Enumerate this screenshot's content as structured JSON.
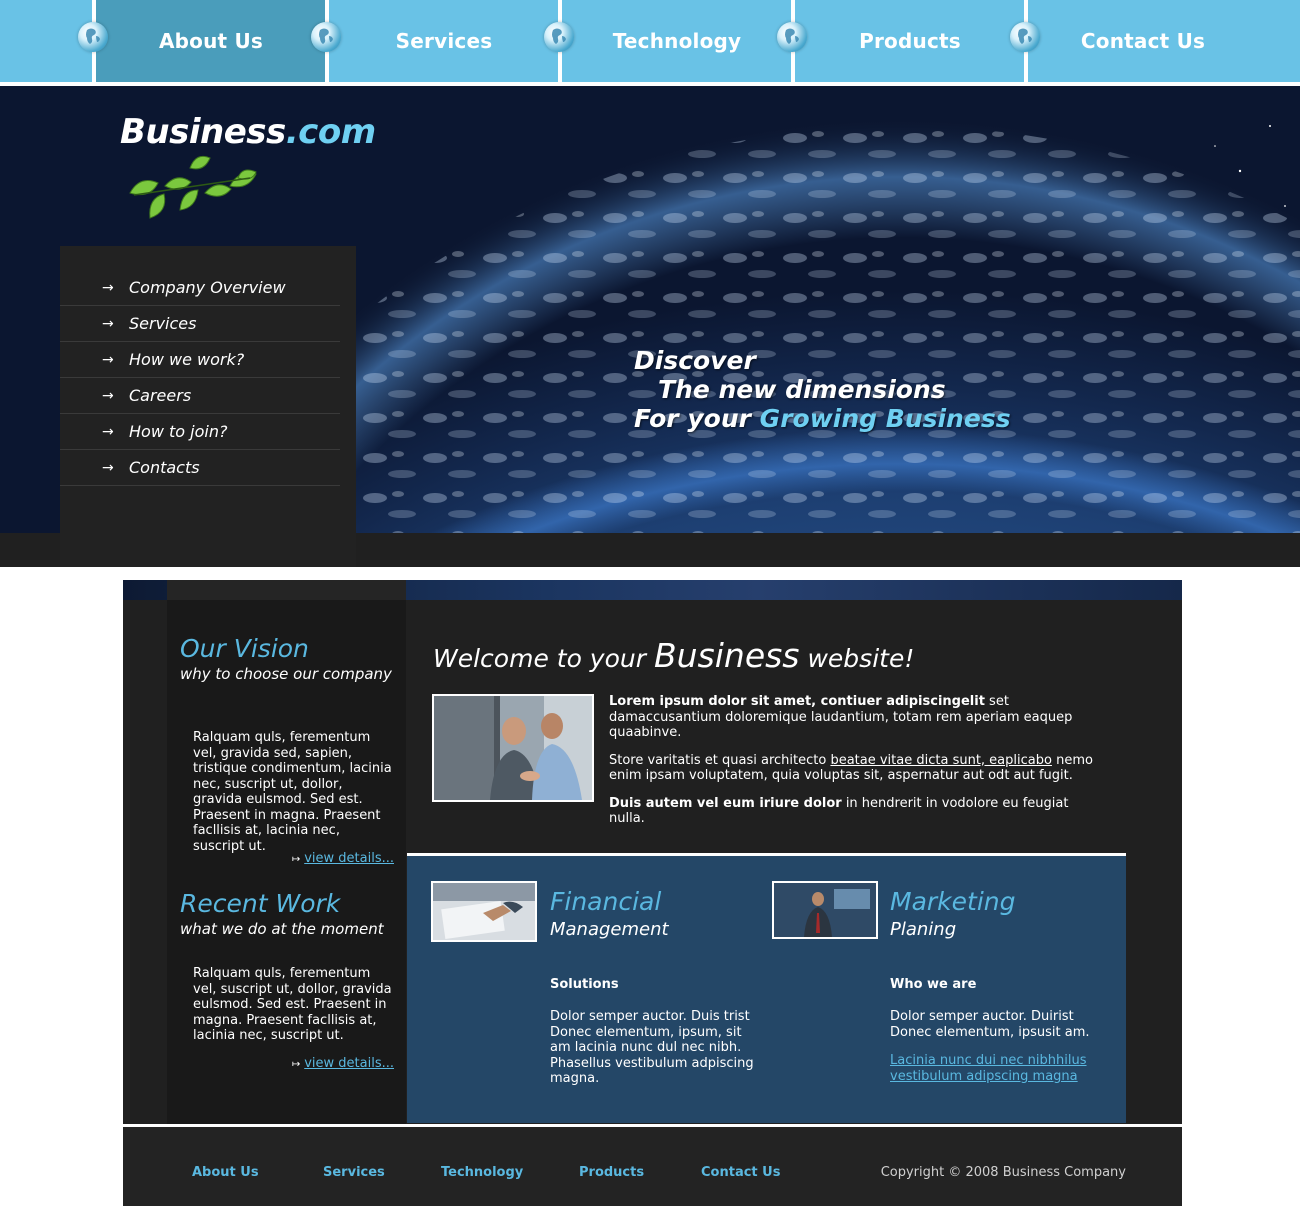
{
  "nav": {
    "items": [
      {
        "label": "About Us",
        "active": true
      },
      {
        "label": "Services",
        "active": false
      },
      {
        "label": "Technology",
        "active": false
      },
      {
        "label": "Products",
        "active": false
      },
      {
        "label": "Contact Us",
        "active": false
      }
    ]
  },
  "hero": {
    "brand_main": "Business",
    "brand_ext": ".com",
    "menu": [
      {
        "label": "Company Overview"
      },
      {
        "label": "Services"
      },
      {
        "label": "How we work?"
      },
      {
        "label": "Careers"
      },
      {
        "label": "How to join?"
      },
      {
        "label": "Contacts"
      }
    ],
    "arrow": "→",
    "slogan_line1": "Discover",
    "slogan_line2": "The new dimensions",
    "slogan_line3_prefix": "For your",
    "slogan_line3_highlight": "Growing Business"
  },
  "vision": {
    "title": "Our Vision",
    "subtitle": "why to choose our company",
    "body": "Ralquam quls, ferementum vel, gravida sed, sapien, tristique condimentum, lacinia nec, suscript ut, dollor, gravida eulsmod. Sed est. Praesent in magna. Praesent facllisis at, lacinia nec, suscript ut.",
    "more": "view details..."
  },
  "recent": {
    "title": "Recent Work",
    "subtitle": "what we do at the moment",
    "body": "Ralquam quls, ferementum vel, suscript ut, dollor, gravida eulsmod. Sed est. Praesent in magna. Praesent facllisis at, lacinia nec, suscript ut.",
    "more": "view details..."
  },
  "welcome": {
    "prefix": "Welcome to your",
    "big": "Business",
    "suffix": "website!",
    "p1_bold": "Lorem ipsum dolor sit amet, contiuer adipiscingelit",
    "p1_rest": " set damaccusantium doloremique laudantium, totam rem aperiam eaquep quaabinve.",
    "p2_pre": "Store varitatis et quasi architecto ",
    "p2_link": "beatae vitae dicta sunt, eaplicabo",
    "p2_post": " nemo enim ipsam voluptatem, quia voluptas sit, aspernatur aut odt aut fugit.",
    "p3_bold": "Duis autem vel eum iriure dolor",
    "p3_rest": " in hendrerit in vodolore eu feugiat nulla."
  },
  "financial": {
    "title": "Financial",
    "subtitle": "Management",
    "heading": "Solutions",
    "body": "Dolor semper auctor. Duis trist Donec elementum, ipsum, sit am lacinia nunc dul nec nibh. Phasellus vestibulum adpiscing magna."
  },
  "marketing": {
    "title": "Marketing",
    "subtitle": "Planing",
    "heading": "Who we are",
    "body": "Dolor semper auctor. Duirist Donec elementum, ipsusit am.",
    "link": "Lacinia nunc dui nec nibhhilus vestibulum adipscing magna"
  },
  "footer": {
    "links": [
      {
        "label": "About Us"
      },
      {
        "label": "Services"
      },
      {
        "label": "Technology"
      },
      {
        "label": "Products"
      },
      {
        "label": "Contact Us"
      }
    ],
    "copyright": "Copyright © 2008 Business Company"
  },
  "colors": {
    "nav_bg": "#69c2e6",
    "nav_active": "#4a9dbb",
    "accent": "#5ab8e0",
    "dark_bg": "#202020",
    "blue_box": "#244767"
  },
  "icons": [
    "globe-icon",
    "arrow-right-icon",
    "leaves-logo-icon"
  ]
}
